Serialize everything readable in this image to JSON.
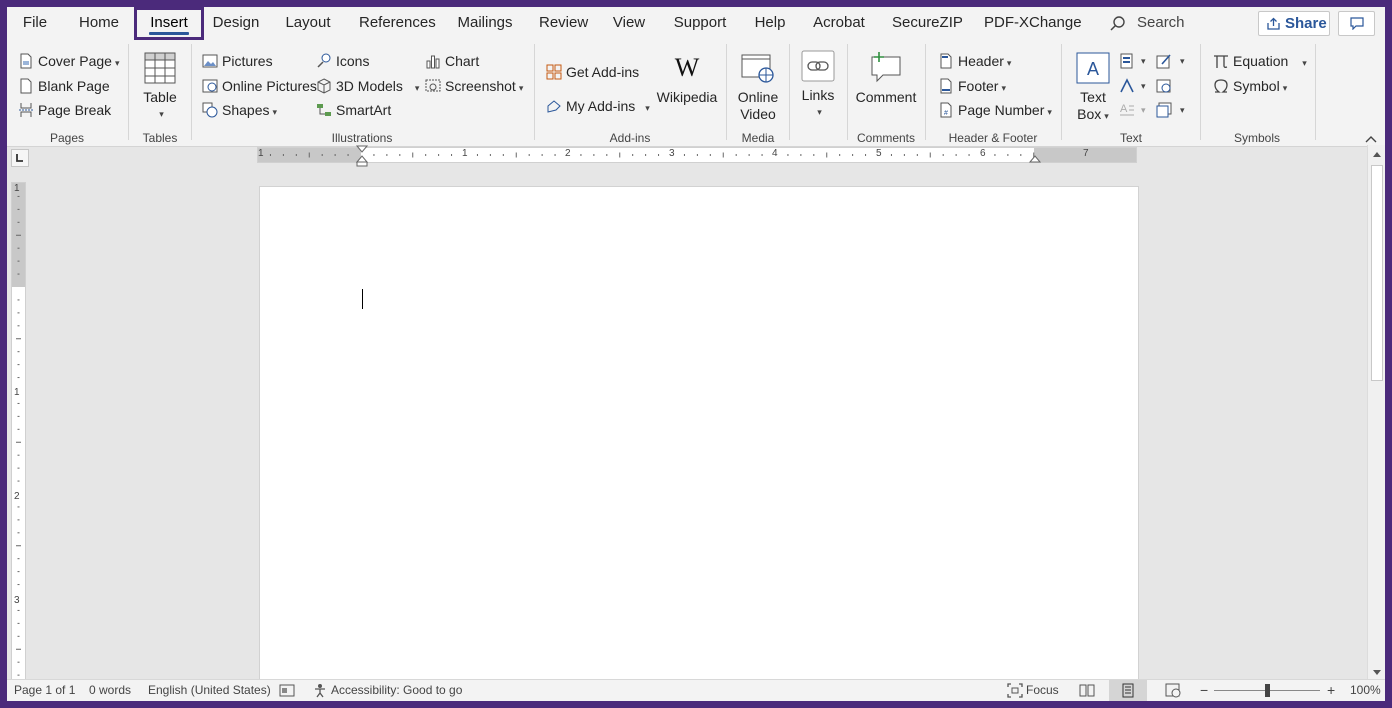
{
  "tabs": [
    "File",
    "Home",
    "Insert",
    "Design",
    "Layout",
    "References",
    "Mailings",
    "Review",
    "View",
    "Support",
    "Help",
    "Acrobat",
    "SecureZIP",
    "PDF-XChange"
  ],
  "active_tab": "Insert",
  "search_label": "Search",
  "share_label": "Share",
  "groups": {
    "pages": {
      "label": "Pages",
      "items": [
        "Cover Page",
        "Blank Page",
        "Page Break"
      ]
    },
    "tables": {
      "label": "Tables",
      "table": "Table"
    },
    "illustrations": {
      "label": "Illustrations",
      "pictures": "Pictures",
      "online_pictures": "Online Pictures",
      "shapes": "Shapes",
      "icons": "Icons",
      "models_3d": "3D Models",
      "smartart": "SmartArt",
      "chart": "Chart",
      "screenshot": "Screenshot"
    },
    "addins": {
      "label": "Add-ins",
      "get_addins": "Get Add-ins",
      "my_addins": "My Add-ins",
      "wikipedia": "Wikipedia"
    },
    "media": {
      "label": "Media",
      "online_video_line1": "Online",
      "online_video_line2": "Video"
    },
    "links": {
      "label": "Links"
    },
    "comments": {
      "label": "Comments",
      "comment": "Comment"
    },
    "header_footer": {
      "label": "Header & Footer",
      "header": "Header",
      "footer": "Footer",
      "page_number": "Page Number"
    },
    "text": {
      "label": "Text",
      "text_box_line1": "Text",
      "text_box_line2": "Box"
    },
    "symbols": {
      "label": "Symbols",
      "equation": "Equation",
      "symbol": "Symbol"
    }
  },
  "ruler": {
    "h_numbers": [
      "1",
      "1",
      "2",
      "3",
      "4",
      "5",
      "6",
      "7"
    ],
    "v_numbers": [
      "1",
      "1",
      "2",
      "3"
    ]
  },
  "status": {
    "page": "Page 1 of 1",
    "words": "0 words",
    "language": "English (United States)",
    "accessibility": "Accessibility: Good to go",
    "focus": "Focus",
    "zoom": "100%",
    "zoom_minus": "−",
    "zoom_plus": "+"
  },
  "colors": {
    "accent": "#2b579a",
    "frame": "#4b2a7b"
  }
}
